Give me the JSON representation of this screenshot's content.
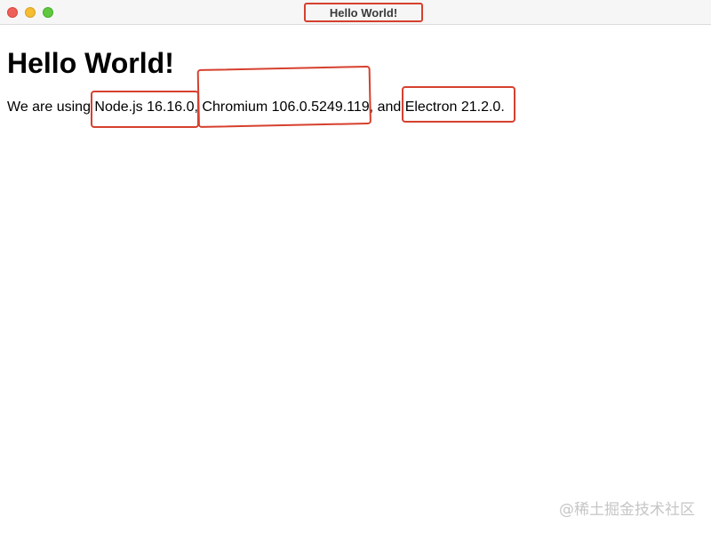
{
  "window": {
    "title": "Hello World!"
  },
  "page": {
    "heading": "Hello World!",
    "text_prefix": "We are using ",
    "node_label": "Node.js ",
    "node_version": "16.16.0",
    "sep1": ", ",
    "chrome_label": "Chromium ",
    "chrome_version": "106.0.5249.119",
    "sep2": ", and ",
    "electron_label": "Electron ",
    "electron_version": "21.2.0",
    "suffix": "."
  },
  "watermark": "@稀土掘金技术社区",
  "colors": {
    "highlight_border": "#d6402e",
    "close": "#ee5f57",
    "minimize": "#f5bd2f",
    "zoom": "#5fc83f"
  }
}
